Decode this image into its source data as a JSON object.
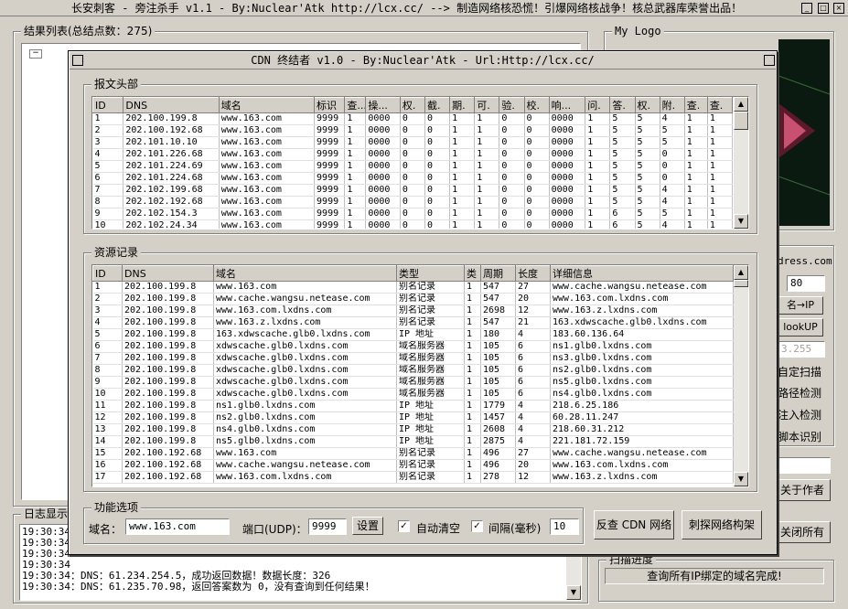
{
  "main_window": {
    "title": "长安刺客 - 旁注杀手 v1.1 - By:Nuclear'Atk  http://lcx.cc/ --> 制造网络核恐慌！引爆网络核战争！核总武器库荣誉出品！",
    "results_group": "结果列表(总结点数：275)",
    "logo_group": "My Logo",
    "address_label": "dress.com",
    "port_value": "80",
    "btn_name_to_ip": "名→IP",
    "btn_lookup": "lookUP",
    "ip_placeholder": "3.255",
    "opt_custom_scan": "自定扫描",
    "opt_path_check": "路径检测",
    "opt_inject_check": "注入检测",
    "opt_script_detect": "脚本识别",
    "btn_about": "关于作者",
    "btn_close_all": "关闭所有",
    "log_group": "日志显示",
    "progress_group": "扫描进度",
    "progress_text": "查询所有IP绑定的域名完成!",
    "log_lines": [
      "19:30:34",
      "19:30:34",
      "19:30:34",
      "19:30:34",
      "19:30:34：DNS：61.234.254.5，成功返回数据！数据长度：326",
      "19:30:34：DNS：61.235.70.98，返回答案数为 0，没有查询到任何结果！"
    ]
  },
  "cdn_window": {
    "title": "CDN 终结者 v1.0 - By:Nuclear'Atk - Url:Http://lcx.cc/",
    "header_group": "报文头部",
    "header_columns": [
      "ID",
      "DNS",
      "域名",
      "标识",
      "查...",
      "操...",
      "权.",
      "截.",
      "期.",
      "可.",
      "验.",
      "校.",
      "响...",
      "问.",
      "答.",
      "权.",
      "附.",
      "查.",
      "查."
    ],
    "header_rows": [
      [
        "1",
        "202.100.199.8",
        "www.163.com",
        "9999",
        "1",
        "0000",
        "0",
        "0",
        "1",
        "1",
        "0",
        "0",
        "0000",
        "1",
        "5",
        "5",
        "4",
        "1",
        "1"
      ],
      [
        "2",
        "202.100.192.68",
        "www.163.com",
        "9999",
        "1",
        "0000",
        "0",
        "0",
        "1",
        "1",
        "0",
        "0",
        "0000",
        "1",
        "5",
        "5",
        "5",
        "1",
        "1"
      ],
      [
        "3",
        "202.101.10.10",
        "www.163.com",
        "9999",
        "1",
        "0000",
        "0",
        "0",
        "1",
        "1",
        "0",
        "0",
        "0000",
        "1",
        "5",
        "5",
        "5",
        "1",
        "1"
      ],
      [
        "4",
        "202.101.226.68",
        "www.163.com",
        "9999",
        "1",
        "0000",
        "0",
        "0",
        "1",
        "1",
        "0",
        "0",
        "0000",
        "1",
        "5",
        "5",
        "0",
        "1",
        "1"
      ],
      [
        "5",
        "202.101.224.69",
        "www.163.com",
        "9999",
        "1",
        "0000",
        "0",
        "0",
        "1",
        "1",
        "0",
        "0",
        "0000",
        "1",
        "5",
        "5",
        "0",
        "1",
        "1"
      ],
      [
        "6",
        "202.101.224.68",
        "www.163.com",
        "9999",
        "1",
        "0000",
        "0",
        "0",
        "1",
        "1",
        "0",
        "0",
        "0000",
        "1",
        "5",
        "5",
        "0",
        "1",
        "1"
      ],
      [
        "7",
        "202.102.199.68",
        "www.163.com",
        "9999",
        "1",
        "0000",
        "0",
        "0",
        "1",
        "1",
        "0",
        "0",
        "0000",
        "1",
        "5",
        "5",
        "4",
        "1",
        "1"
      ],
      [
        "8",
        "202.102.192.68",
        "www.163.com",
        "9999",
        "1",
        "0000",
        "0",
        "0",
        "1",
        "1",
        "0",
        "0",
        "0000",
        "1",
        "5",
        "5",
        "4",
        "1",
        "1"
      ],
      [
        "9",
        "202.102.154.3",
        "www.163.com",
        "9999",
        "1",
        "0000",
        "0",
        "0",
        "1",
        "1",
        "0",
        "0",
        "0000",
        "1",
        "6",
        "5",
        "5",
        "1",
        "1"
      ],
      [
        "10",
        "202.102.24.34",
        "www.163.com",
        "9999",
        "1",
        "0000",
        "0",
        "0",
        "1",
        "1",
        "0",
        "0",
        "0000",
        "1",
        "6",
        "5",
        "4",
        "1",
        "1"
      ]
    ],
    "res_group": "资源记录",
    "res_columns": [
      "ID",
      "DNS",
      "域名",
      "类型",
      "类",
      "周期",
      "长度",
      "详细信息"
    ],
    "res_rows": [
      [
        "1",
        "202.100.199.8",
        "www.163.com",
        "别名记录",
        "1",
        "547",
        "27",
        "www.cache.wangsu.netease.com"
      ],
      [
        "2",
        "202.100.199.8",
        "www.cache.wangsu.netease.com",
        "别名记录",
        "1",
        "547",
        "20",
        "www.163.com.lxdns.com"
      ],
      [
        "3",
        "202.100.199.8",
        "www.163.com.lxdns.com",
        "别名记录",
        "1",
        "2698",
        "12",
        "www.163.z.lxdns.com"
      ],
      [
        "4",
        "202.100.199.8",
        "www.163.z.lxdns.com",
        "别名记录",
        "1",
        "547",
        "21",
        "163.xdwscache.glb0.lxdns.com"
      ],
      [
        "5",
        "202.100.199.8",
        "163.xdwscache.glb0.lxdns.com",
        "IP 地址",
        "1",
        "180",
        "4",
        "183.60.136.64"
      ],
      [
        "6",
        "202.100.199.8",
        "xdwscache.glb0.lxdns.com",
        "域名服务器",
        "1",
        "105",
        "6",
        "ns1.glb0.lxdns.com"
      ],
      [
        "7",
        "202.100.199.8",
        "xdwscache.glb0.lxdns.com",
        "域名服务器",
        "1",
        "105",
        "6",
        "ns3.glb0.lxdns.com"
      ],
      [
        "8",
        "202.100.199.8",
        "xdwscache.glb0.lxdns.com",
        "域名服务器",
        "1",
        "105",
        "6",
        "ns2.glb0.lxdns.com"
      ],
      [
        "9",
        "202.100.199.8",
        "xdwscache.glb0.lxdns.com",
        "域名服务器",
        "1",
        "105",
        "6",
        "ns5.glb0.lxdns.com"
      ],
      [
        "10",
        "202.100.199.8",
        "xdwscache.glb0.lxdns.com",
        "域名服务器",
        "1",
        "105",
        "6",
        "ns4.glb0.lxdns.com"
      ],
      [
        "11",
        "202.100.199.8",
        "ns1.glb0.lxdns.com",
        "IP 地址",
        "1",
        "1779",
        "4",
        "218.6.25.186"
      ],
      [
        "12",
        "202.100.199.8",
        "ns2.glb0.lxdns.com",
        "IP 地址",
        "1",
        "1457",
        "4",
        "60.28.11.247"
      ],
      [
        "13",
        "202.100.199.8",
        "ns4.glb0.lxdns.com",
        "IP 地址",
        "1",
        "2608",
        "4",
        "218.60.31.212"
      ],
      [
        "14",
        "202.100.199.8",
        "ns5.glb0.lxdns.com",
        "IP 地址",
        "1",
        "2875",
        "4",
        "221.181.72.159"
      ],
      [
        "15",
        "202.100.192.68",
        "www.163.com",
        "别名记录",
        "1",
        "496",
        "27",
        "www.cache.wangsu.netease.com"
      ],
      [
        "16",
        "202.100.192.68",
        "www.cache.wangsu.netease.com",
        "别名记录",
        "1",
        "496",
        "20",
        "www.163.com.lxdns.com"
      ],
      [
        "17",
        "202.100.192.68",
        "www.163.com.lxdns.com",
        "别名记录",
        "1",
        "278",
        "12",
        "www.163.z.lxdns.com"
      ]
    ],
    "options_group": "功能选项",
    "domain_label": "域名：",
    "domain_value": "www.163.com",
    "port_label": "端口(UDP)：",
    "port_value": "9999",
    "btn_set": "设置",
    "chk_autoclear": "自动清空",
    "chk_interval": "间隔(毫秒)",
    "interval_value": "10",
    "btn_reverse": "反查 CDN 网络",
    "btn_probe": "刺探网络构架"
  }
}
